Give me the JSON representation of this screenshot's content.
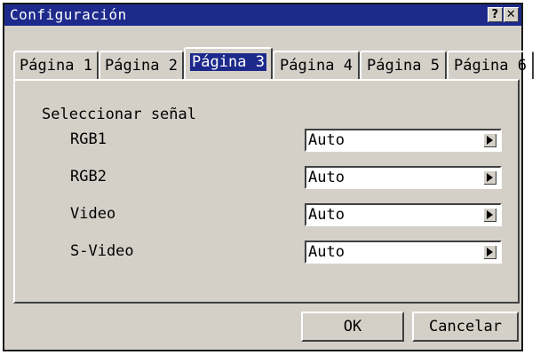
{
  "window": {
    "title": "Configuración",
    "help_glyph": "?",
    "close_glyph": "✕"
  },
  "tabs": [
    {
      "label": "Página 1",
      "active": false
    },
    {
      "label": "Página 2",
      "active": false
    },
    {
      "label": "Página 3",
      "active": true
    },
    {
      "label": "Página 4",
      "active": false
    },
    {
      "label": "Página 5",
      "active": false
    },
    {
      "label": "Página 6",
      "active": false
    }
  ],
  "panel": {
    "section_label": "Seleccionar señal",
    "rows": [
      {
        "label": "RGB1",
        "value": "Auto"
      },
      {
        "label": "RGB2",
        "value": "Auto"
      },
      {
        "label": "Video",
        "value": "Auto"
      },
      {
        "label": "S-Video",
        "value": "Auto"
      }
    ]
  },
  "buttons": {
    "ok_label": "OK",
    "cancel_label": "Cancelar"
  },
  "colors": {
    "title_bar": "#1d2a8c",
    "dialog_face": "#d4d0c8",
    "active_tab_highlight": "#1d2a8c"
  },
  "icons": {
    "dropdown_arrow": "triangle-right-icon"
  }
}
